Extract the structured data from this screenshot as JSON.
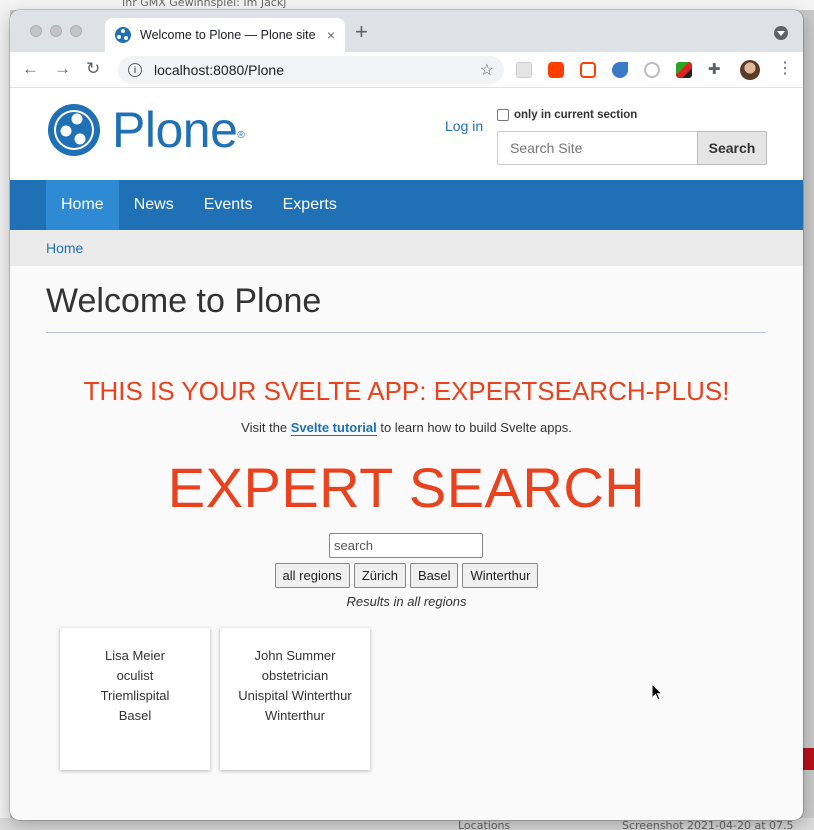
{
  "background": {
    "top_text": "Ihr GMX Gewinnspiel: Im Jackj",
    "bottom_label": "Locations",
    "bottom_right": "Screenshot 2021-04-20 at 07.5"
  },
  "browser": {
    "tab_title": "Welcome to Plone — Plone site",
    "tab_close": "×",
    "new_tab": "+",
    "url": "localhost:8080/Plone",
    "back": "←",
    "forward": "→",
    "reload": "↻",
    "star": "☆",
    "kebab": "⋮"
  },
  "header": {
    "logo_text": "Plone",
    "logo_reg": "®",
    "login": "Log in",
    "only_current_section": "only in current section",
    "search_placeholder": "Search Site",
    "search_button": "Search"
  },
  "nav": {
    "items": [
      "Home",
      "News",
      "Events",
      "Experts"
    ]
  },
  "breadcrumb": "Home",
  "main": {
    "title": "Welcome to Plone",
    "svelte_heading": "THIS IS YOUR SVELTE APP: EXPERTSEARCH-PLUS!",
    "visit_prefix": "Visit the ",
    "tutorial_link": "Svelte tutorial",
    "visit_suffix": " to learn how to build Svelte apps.",
    "expert_title": "EXPERT SEARCH",
    "search_value": "search",
    "regions": [
      "all regions",
      "Zürich",
      "Basel",
      "Winterthur"
    ],
    "results_note": "Results in all regions",
    "experts": [
      {
        "name": "Lisa Meier",
        "profession": "oculist",
        "hospital": "Triemlispital",
        "city": "Basel"
      },
      {
        "name": "John Summer",
        "profession": "obstetrician",
        "hospital": "Unispital Winterthur",
        "city": "Winterthur"
      }
    ]
  },
  "colors": {
    "plone_blue": "#1f70b5",
    "svelte_orange": "#e8431e"
  }
}
